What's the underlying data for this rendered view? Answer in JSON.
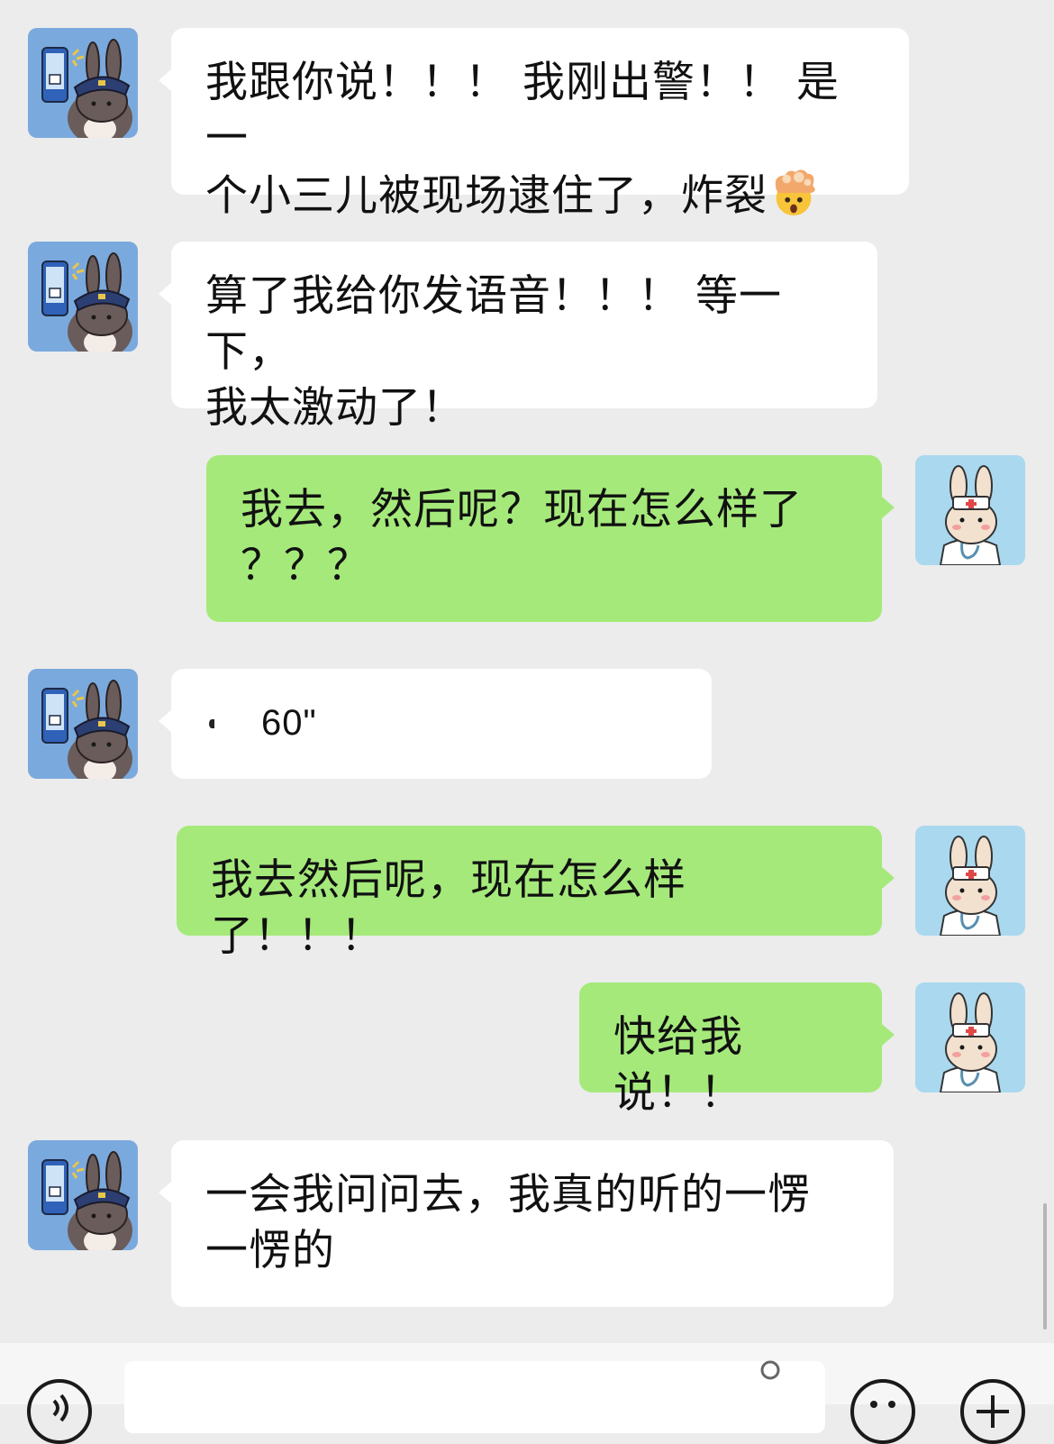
{
  "messages": [
    {
      "side": "incoming",
      "sender": "police-bunny",
      "text_lines": [
        "我跟你说！！！ 我刚出警！！ 是一",
        "个小三儿被现场逮住了，炸裂"
      ],
      "emoji": "exploding-head-emoji"
    },
    {
      "side": "incoming",
      "sender": "police-bunny",
      "text_lines": [
        "算了我给你发语音！！！ 等一下，",
        "我太激动了！"
      ]
    },
    {
      "side": "outgoing",
      "sender": "doctor-bunny",
      "text_lines": [
        "我去，然后呢？现在怎么样了",
        "？？？"
      ]
    },
    {
      "side": "incoming",
      "sender": "police-bunny",
      "voice_duration": "60\""
    },
    {
      "side": "outgoing",
      "sender": "doctor-bunny",
      "text_lines": [
        "我去然后呢，现在怎么样了！！！"
      ]
    },
    {
      "side": "outgoing",
      "sender": "doctor-bunny",
      "text_lines": [
        "快给我说！！"
      ]
    },
    {
      "side": "incoming",
      "sender": "police-bunny",
      "text_lines": [
        "一会我问问去，我真的听的一愣",
        "一愣的"
      ]
    }
  ],
  "colors": {
    "background": "#ececec",
    "incoming_bubble": "#ffffff",
    "outgoing_bubble": "#a5e97b",
    "police_avatar_bg": "#7aa9dd",
    "doctor_avatar_bg": "#a9d8ef"
  },
  "icons": {
    "voice_toggle": "voice-mode-icon",
    "emoji_button": "emoji-icon",
    "more_button": "plus-icon"
  }
}
